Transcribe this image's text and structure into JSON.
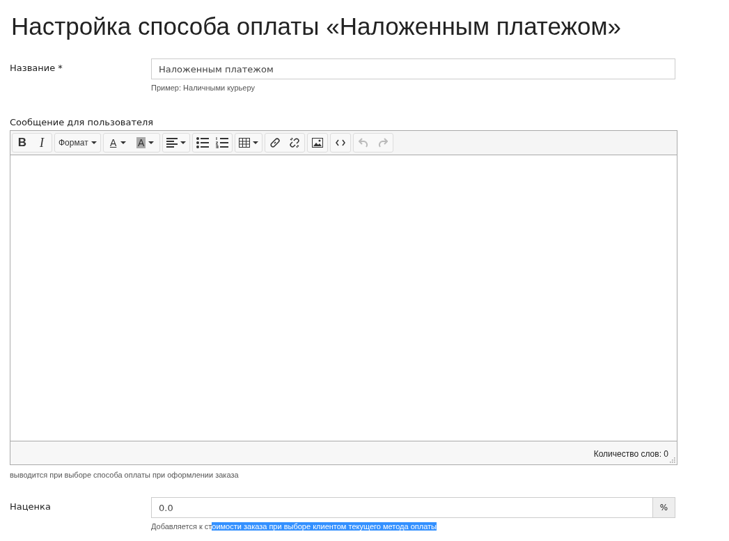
{
  "title": "Настройка способа оплаты «Наложенным платежом»",
  "name_field": {
    "label": "Название *",
    "value": "Наложенным платежом",
    "hint": "Пример: Наличными курьеру"
  },
  "editor": {
    "label": "Сообщение для пользователя",
    "toolbar": [
      [
        {
          "kind": "bold",
          "label": "B",
          "disabled": false
        },
        {
          "kind": "italic",
          "label": "I",
          "disabled": false
        }
      ],
      [
        {
          "kind": "format",
          "label": "Формат",
          "disabled": false
        }
      ],
      [
        {
          "kind": "text-color",
          "label": "A",
          "disabled": false
        },
        {
          "kind": "bg-color",
          "label": "A",
          "disabled": false
        }
      ],
      [
        {
          "kind": "align",
          "disabled": false
        }
      ],
      [
        {
          "kind": "bullet-list",
          "disabled": false
        },
        {
          "kind": "number-list",
          "disabled": false
        }
      ],
      [
        {
          "kind": "table",
          "disabled": false
        }
      ],
      [
        {
          "kind": "link",
          "disabled": false
        },
        {
          "kind": "unlink",
          "disabled": false
        }
      ],
      [
        {
          "kind": "image",
          "disabled": false
        }
      ],
      [
        {
          "kind": "code",
          "disabled": false
        }
      ],
      [
        {
          "kind": "undo",
          "disabled": true
        },
        {
          "kind": "redo",
          "disabled": true
        }
      ]
    ],
    "word_count": "Количество слов: 0",
    "hint": "выводится при выборе способа оплаты при оформлении заказа"
  },
  "markup_field": {
    "label": "Наценка",
    "value": "0.0",
    "addon": "%",
    "hint_before": "Добавляется к ст",
    "hint_selected": "оимости заказа при выборе клиентом текущего метода оплаты"
  }
}
